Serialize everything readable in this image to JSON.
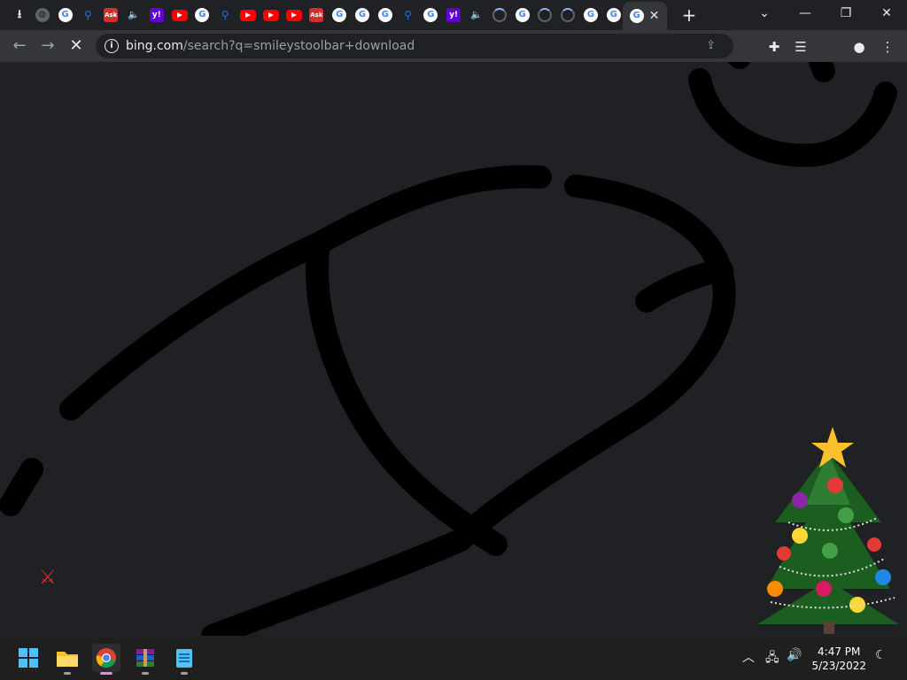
{
  "browser": {
    "tabs": [
      {
        "icon": "download-icon",
        "type": "dl",
        "glyph": "⭳"
      },
      {
        "icon": "globe-icon",
        "type": "globe",
        "glyph": "◍"
      },
      {
        "icon": "google-icon",
        "type": "g",
        "glyph": ""
      },
      {
        "icon": "search-icon",
        "type": "search",
        "glyph": "⚲"
      },
      {
        "icon": "ask-icon",
        "type": "ask",
        "glyph": "Ask"
      },
      {
        "icon": "audio-icon",
        "type": "audio",
        "glyph": "🔈"
      },
      {
        "icon": "yahoo-icon",
        "type": "yahoo",
        "glyph": "y!"
      },
      {
        "icon": "youtube-icon",
        "type": "yt",
        "glyph": ""
      },
      {
        "icon": "google-icon",
        "type": "g",
        "glyph": ""
      },
      {
        "icon": "search-icon",
        "type": "search",
        "glyph": "⚲"
      },
      {
        "icon": "youtube-icon",
        "type": "yt",
        "glyph": ""
      },
      {
        "icon": "youtube-icon",
        "type": "yt",
        "glyph": ""
      },
      {
        "icon": "youtube-icon",
        "type": "yt",
        "glyph": ""
      },
      {
        "icon": "ask-icon",
        "type": "ask",
        "glyph": "Ask"
      },
      {
        "icon": "google-icon",
        "type": "g",
        "glyph": ""
      },
      {
        "icon": "google-icon",
        "type": "g",
        "glyph": ""
      },
      {
        "icon": "google-icon",
        "type": "g",
        "glyph": ""
      },
      {
        "icon": "search-icon",
        "type": "search",
        "glyph": "⚲"
      },
      {
        "icon": "google-icon",
        "type": "g",
        "glyph": ""
      },
      {
        "icon": "yahoo-icon",
        "type": "yahoo",
        "glyph": "y!"
      },
      {
        "icon": "audio-icon",
        "type": "audio",
        "glyph": "🔈"
      },
      {
        "icon": "loading-spinner-icon",
        "type": "spin",
        "glyph": ""
      },
      {
        "icon": "google-icon",
        "type": "g",
        "glyph": ""
      },
      {
        "icon": "loading-spinner-icon",
        "type": "spin",
        "glyph": ""
      },
      {
        "icon": "loading-spinner-icon",
        "type": "spin",
        "glyph": ""
      },
      {
        "icon": "google-icon",
        "type": "g",
        "glyph": ""
      },
      {
        "icon": "google-icon",
        "type": "g",
        "glyph": ""
      }
    ],
    "active_tab": {
      "icon": "google-icon",
      "close": "✕"
    },
    "new_tab": "+",
    "window_controls": {
      "dropdown": "⌄",
      "minimize": "—",
      "restore": "❐",
      "close": "✕"
    },
    "nav": {
      "back": "←",
      "forward": "→",
      "stop": "✕"
    },
    "omnibox": {
      "info": "i",
      "host": "bing.com",
      "path": "/search?q=smileystoolbar+download",
      "share": "⇪"
    },
    "toolbar_icons": {
      "extensions": "✚",
      "reading_list": "☰",
      "profile": "●",
      "menu": "⋮"
    }
  },
  "taskbar": {
    "apps": [
      {
        "name": "start-button",
        "icon": "windows-icon"
      },
      {
        "name": "file-explorer",
        "icon": "folder-icon"
      },
      {
        "name": "chrome",
        "icon": "chrome-icon"
      },
      {
        "name": "winrar",
        "icon": "winrar-icon"
      },
      {
        "name": "notepad",
        "icon": "notepad-icon"
      }
    ],
    "tray": {
      "chevron": "︿",
      "network": "🖧",
      "volume": "🔊",
      "night": "☾"
    },
    "time": "4:47 PM",
    "date": "5/23/2022"
  },
  "colors": {
    "accent": "#e68fd1",
    "tab_bg": "#202124",
    "toolbar_bg": "#35363a"
  }
}
